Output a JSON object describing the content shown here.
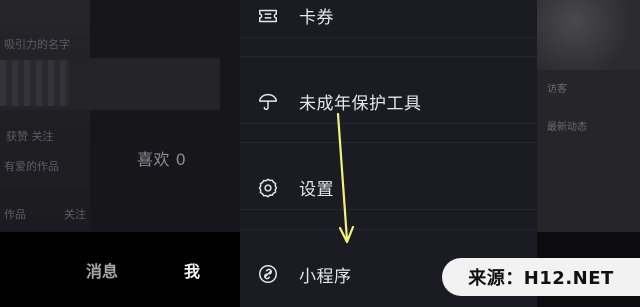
{
  "background": {
    "ghost_lines": [
      "吸引力的名字",
      "获赞 关注",
      "有爱的作品",
      "作品",
      "关注"
    ],
    "likes_label": "喜欢 0",
    "tabbar": {
      "messages_label": "消息",
      "me_label": "我"
    },
    "right_ghost_lines": [
      "访客",
      "最新动态"
    ]
  },
  "drawer": {
    "items": [
      {
        "label": "卡券",
        "icon": "ticket-icon"
      },
      {
        "label": "未成年保护工具",
        "icon": "umbrella-icon"
      },
      {
        "label": "设置",
        "icon": "gear-icon"
      },
      {
        "label": "小程序",
        "icon": "link-icon"
      }
    ]
  },
  "annotation": {
    "arrow_color": "#f2f27a",
    "type": "arrow-down"
  },
  "watermark": {
    "text": "来源：H12.NET"
  },
  "colors": {
    "drawer_bg": "#1b1c23",
    "divider": "#26272e",
    "text": "#e6e6ea"
  }
}
